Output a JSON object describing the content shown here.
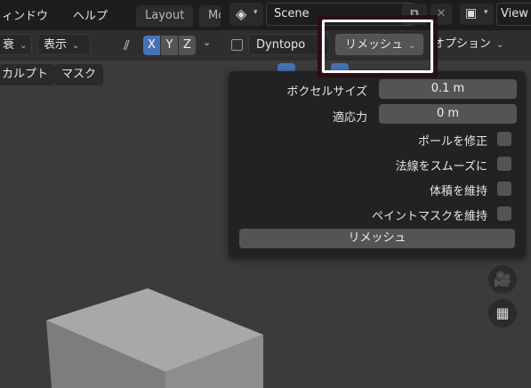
{
  "topbar": {
    "menu": [
      "ィンドウ",
      "ヘルプ"
    ],
    "workspace_tabs": [
      "Layout",
      "Mo"
    ],
    "scene_name": "Scene",
    "view_label": "View"
  },
  "header": {
    "falloff_label": "衰",
    "view_menu_label": "表示",
    "axes": [
      "X",
      "Y",
      "Z"
    ],
    "dyntopo_label": "Dyntopo",
    "remesh_label": "リメッシュ",
    "options_label": "オプション"
  },
  "mode_buttons": [
    "カルプト",
    "マスク"
  ],
  "remesh_panel": {
    "voxel_size_label": "ボクセルサイズ",
    "voxel_size_value": "0.1 m",
    "adaptivity_label": "適応力",
    "adaptivity_value": "0 m",
    "checkboxes": [
      {
        "label": "ポールを修正",
        "checked": false
      },
      {
        "label": "法線をスムーズに",
        "checked": false
      },
      {
        "label": "体積を維持",
        "checked": false
      },
      {
        "label": "ペイントマスクを維持",
        "checked": false
      }
    ],
    "remesh_button": "リメッシュ"
  },
  "colors": {
    "accent_blue": "#4772b3",
    "popover_bg": "#222222",
    "field_bg": "#545454",
    "highlight": "#ffffff"
  }
}
